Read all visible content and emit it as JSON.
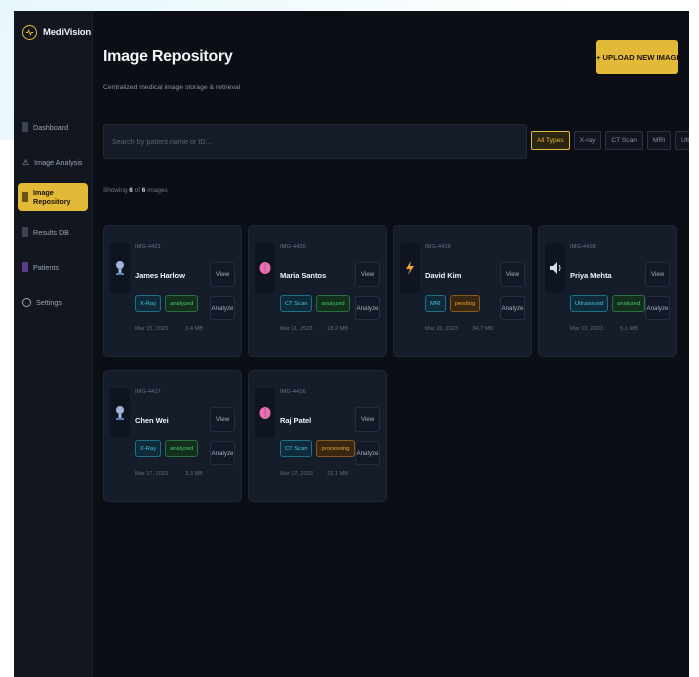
{
  "brand": {
    "name": "MediVision"
  },
  "nav": [
    {
      "label": "Dashboard",
      "icon": "dashboard-icon"
    },
    {
      "label": "Image Analysis",
      "icon": "image-analysis-icon"
    },
    {
      "label": "Image Repository",
      "icon": "repository-icon",
      "active": true
    },
    {
      "label": "Results DB",
      "icon": "database-icon"
    },
    {
      "label": "Patients",
      "icon": "patients-icon"
    },
    {
      "label": "Settings",
      "icon": "settings-icon"
    }
  ],
  "header": {
    "title": "Image Repository",
    "subtitle": "Centralized medical image storage & retrieval",
    "upload_label": "+ UPLOAD NEW IMAGE"
  },
  "search": {
    "placeholder": "Search by patient name or ID..."
  },
  "filters": [
    "All Types",
    "X-ray",
    "CT Scan",
    "MRI",
    "Ultrasound"
  ],
  "count": {
    "prefix": "Showing",
    "shown": "6",
    "of": "of",
    "total": "6",
    "suffix": "images"
  },
  "cards": [
    {
      "id": "IMG-4421",
      "name": "James Harlow",
      "type": "X-Ray",
      "status": "analyzed",
      "date": "Mar 15, 2023",
      "size": "2.4 MB",
      "icon": "xray-icon",
      "view": "View",
      "analyze": "Analyze"
    },
    {
      "id": "IMG-4420",
      "name": "Maria Santos",
      "type": "CT Scan",
      "status": "analyzed",
      "date": "Mar 11, 2023",
      "size": "18.2 MB",
      "icon": "brain-icon",
      "view": "View",
      "analyze": "Analyze"
    },
    {
      "id": "IMG-4419",
      "name": "David Kim",
      "type": "MRI",
      "status": "pending",
      "date": "Mar 15, 2023",
      "size": "34.7 MB",
      "icon": "lightning-icon",
      "view": "View",
      "analyze": "Analyze"
    },
    {
      "id": "IMG-4418",
      "name": "Priya Mehta",
      "type": "Ultrasound",
      "status": "analyzed",
      "date": "Mar 13, 2023",
      "size": "5.1 MB",
      "icon": "speaker-icon",
      "view": "View",
      "analyze": "Analyze"
    },
    {
      "id": "IMG-4417",
      "name": "Chen Wei",
      "type": "X-Ray",
      "status": "analyzed",
      "date": "Mar 17, 2023",
      "size": "3.3 MB",
      "icon": "xray-icon",
      "view": "View",
      "analyze": "Analyze"
    },
    {
      "id": "IMG-4416",
      "name": "Raj Patel",
      "type": "CT Scan",
      "status": "processing",
      "date": "Mar 17, 2023",
      "size": "22.1 MB",
      "icon": "brain-icon",
      "view": "View",
      "analyze": "Analyze"
    }
  ],
  "colors": {
    "accent": "#e3b93a",
    "background": "#0b0e14",
    "card": "#151c2a",
    "analyzed": "#49c96b",
    "pending": "#e5a23a",
    "type_tag": "#4fc0e6"
  }
}
